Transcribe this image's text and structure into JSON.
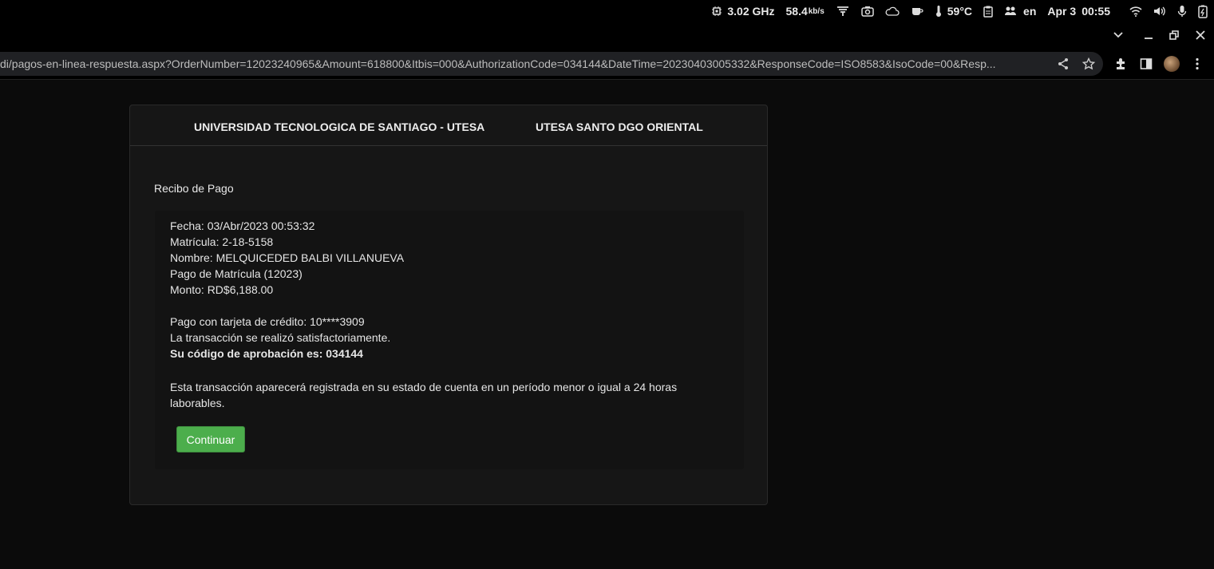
{
  "system_bar": {
    "cpu": "3.02 GHz",
    "net_value": "58.4",
    "net_unit": "kb/s",
    "temperature": "59°C",
    "language": "en",
    "date": "Apr 3",
    "time": "00:55"
  },
  "browser": {
    "url": "di/pagos-en-linea-respuesta.aspx?OrderNumber=12023240965&Amount=618800&Itbis=000&AuthorizationCode=034144&DateTime=20230403005332&ResponseCode=ISO8583&IsoCode=00&Resp..."
  },
  "header": {
    "university": "UNIVERSIDAD TECNOLOGICA DE SANTIAGO - UTESA",
    "campus": "UTESA SANTO DGO ORIENTAL"
  },
  "receipt": {
    "title": "Recibo de Pago",
    "fecha": "Fecha: 03/Abr/2023 00:53:32",
    "matricula": "Matrícula: 2-18-5158",
    "nombre": "Nombre: MELQUICEDED BALBI VILLANUEVA",
    "concepto": "Pago de Matrícula (12023)",
    "monto": "Monto: RD$6,188.00",
    "tarjeta": "Pago con tarjeta de crédito: 10****3909",
    "estado": "La transacción se realizó satisfactoriamente.",
    "aprobacion": "Su código de aprobación es: 034144",
    "nota": "Esta transacción aparecerá registrada en su estado de cuenta en un período menor o igual a 24 horas laborables.",
    "continue_label": "Continuar"
  }
}
